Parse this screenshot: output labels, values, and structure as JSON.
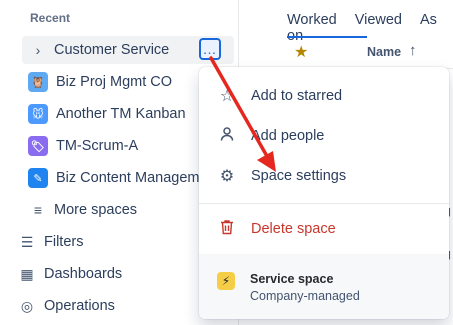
{
  "sidebar": {
    "section_title": "Recent",
    "active_item": {
      "label": "Customer Service",
      "more_label": "…"
    },
    "projects": [
      {
        "label": "Biz Proj Mgmt CO",
        "icon": "owl-avatar-icon",
        "color": "#5fa9f3"
      },
      {
        "label": "Another TM Kanban",
        "icon": "mouse-avatar-icon",
        "color": "#4c9aff"
      },
      {
        "label": "TM-Scrum-A",
        "icon": "tag-avatar-icon",
        "color": "#8a6cf0"
      },
      {
        "label": "Biz Content Managem",
        "icon": "pen-avatar-icon",
        "color": "#1f84f0"
      }
    ],
    "more_spaces": "More spaces",
    "nav": [
      {
        "label": "Filters",
        "icon": "filter-icon"
      },
      {
        "label": "Dashboards",
        "icon": "dashboard-icon"
      },
      {
        "label": "Operations",
        "icon": "operations-icon"
      }
    ]
  },
  "main": {
    "tabs": [
      "Worked on",
      "Viewed",
      "As"
    ],
    "table_header": {
      "name": "Name",
      "sort": "↑"
    }
  },
  "menu": {
    "items": [
      {
        "label": "Add to starred",
        "icon": "star-icon"
      },
      {
        "label": "Add people",
        "icon": "person-icon"
      },
      {
        "label": "Space settings",
        "icon": "gear-icon"
      }
    ],
    "danger_item": {
      "label": "Delete space",
      "icon": "trash-icon"
    },
    "footer": {
      "title": "Service space",
      "subtitle": "Company-managed",
      "icon": "bolt-icon"
    }
  },
  "colors": {
    "accent": "#1868db",
    "danger": "#c9372c",
    "annotation_arrow": "#e5281f"
  }
}
